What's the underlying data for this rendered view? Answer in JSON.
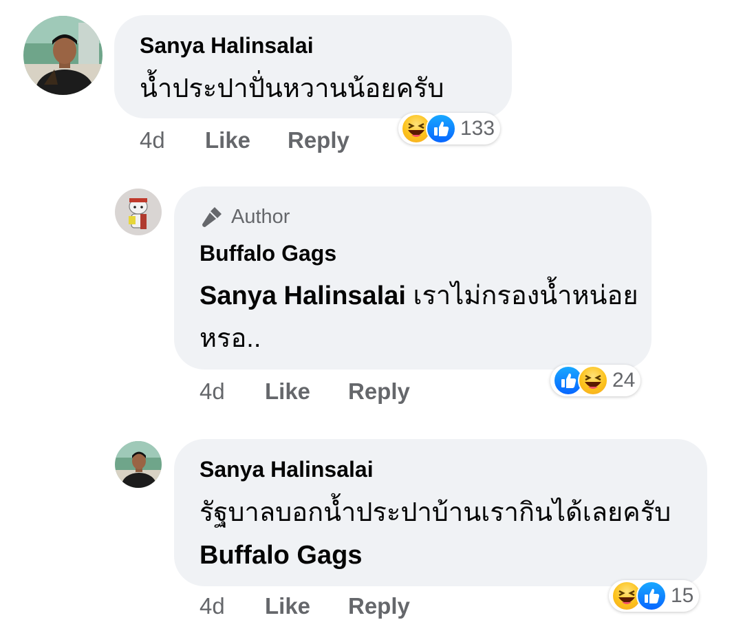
{
  "comments": [
    {
      "author": "Sanya Halinsalai",
      "text": "น้ำประปาปั่นหวานน้อยครับ",
      "time": "4d",
      "like_label": "Like",
      "reply_label": "Reply",
      "reactions": {
        "icons": [
          "haha-icon",
          "like-icon"
        ],
        "count": "133"
      }
    },
    {
      "badge": "Author",
      "author": "Buffalo Gags",
      "mention": "Sanya Halinsalai",
      "text": "เราไม่กรองน้ำหน่อยหรอ..",
      "time": "4d",
      "like_label": "Like",
      "reply_label": "Reply",
      "reactions": {
        "icons": [
          "like-icon",
          "haha-icon"
        ],
        "count": "24"
      }
    },
    {
      "author": "Sanya Halinsalai",
      "text": "รัฐบาลบอกน้ำประปาบ้านเรากินได้เลยครับ",
      "mention": "Buffalo Gags",
      "time": "4d",
      "like_label": "Like",
      "reply_label": "Reply",
      "reactions": {
        "icons": [
          "haha-icon",
          "like-icon"
        ],
        "count": "15"
      }
    }
  ],
  "colors": {
    "bubble": "#f0f2f5",
    "meta_text": "#65676b",
    "like_blue": "#0866ff",
    "haha_yellow": "#fcc21b"
  }
}
